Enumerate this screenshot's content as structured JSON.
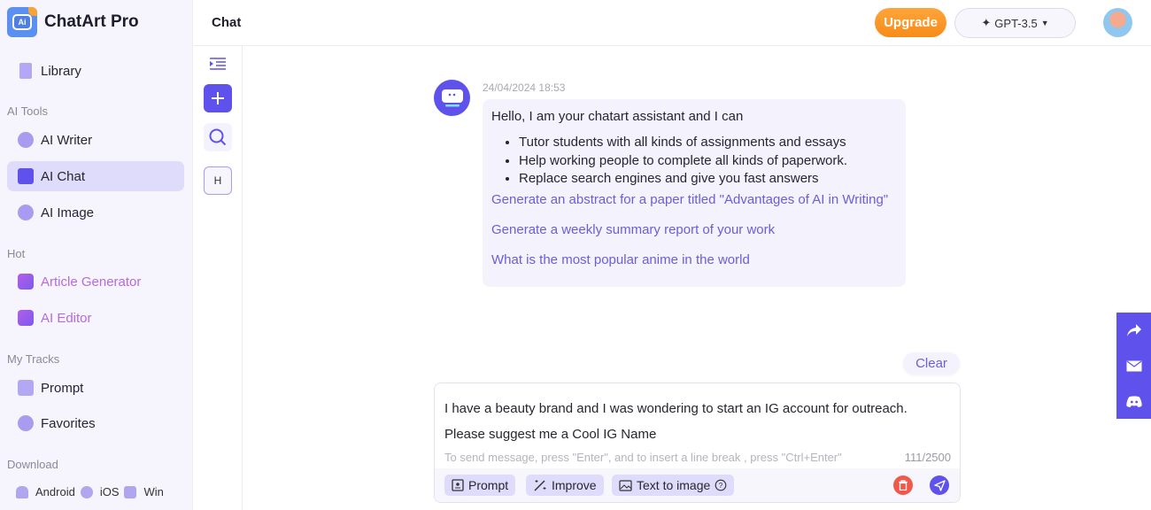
{
  "app": {
    "name": "ChatArt Pro",
    "logo_text": "Ai"
  },
  "sidebar": {
    "library": "Library",
    "sections": {
      "ai_tools": "AI Tools",
      "hot": "Hot",
      "my_tracks": "My Tracks",
      "download": "Download"
    },
    "ai_tools": [
      {
        "label": "AI Writer"
      },
      {
        "label": "AI Chat",
        "active": true
      },
      {
        "label": "AI Image"
      }
    ],
    "hot": [
      {
        "label": "Article Generator"
      },
      {
        "label": "AI Editor"
      }
    ],
    "my_tracks": [
      {
        "label": "Prompt"
      },
      {
        "label": "Favorites"
      }
    ],
    "download": [
      {
        "label": "Android"
      },
      {
        "label": "iOS"
      },
      {
        "label": "Win"
      }
    ]
  },
  "rail": {
    "history_label": "H"
  },
  "header": {
    "title": "Chat",
    "upgrade": "Upgrade",
    "model": "GPT-3.5"
  },
  "chat": {
    "timestamp": "24/04/2024 18:53",
    "greeting": "Hello, I am your chatart assistant and I can",
    "capabilities": [
      "Tutor students with all kinds of assignments and essays",
      "Help working people to complete all kinds of paperwork.",
      "Replace search engines and give you fast answers"
    ],
    "suggestions": [
      "Generate an abstract for a paper titled \"Advantages of AI in Writing\"",
      "Generate a weekly summary report of your work",
      "What is the most popular anime in the world"
    ]
  },
  "composer": {
    "clear": "Clear",
    "line1": "I have a beauty brand and I was wondering to start an IG account for outreach.",
    "line2": "Please suggest me a Cool IG Name",
    "hint": "To send message, press \"Enter\", and to insert a line break , press \"Ctrl+Enter\"",
    "count": "111/2500",
    "buttons": {
      "prompt": "Prompt",
      "improve": "Improve",
      "text_to_image": "Text to image"
    }
  },
  "colors": {
    "accent": "#5f52ec",
    "upgrade": "#f78b1a",
    "delete": "#f0594a"
  }
}
